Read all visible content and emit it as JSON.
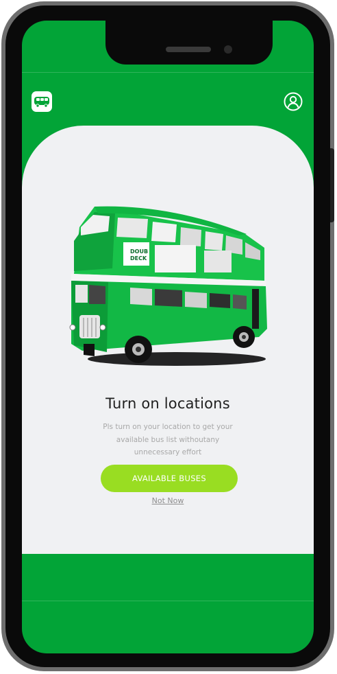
{
  "colors": {
    "primary": "#02a437",
    "card": "#f0f1f3",
    "cta": "#99dd22"
  },
  "header": {
    "logo_icon": "bus-logo-icon",
    "profile_icon": "user-profile-icon"
  },
  "location_prompt": {
    "illustration": "double-decker-bus",
    "title": "Turn on locations",
    "description_lines": [
      "Pls turn on your location to get your",
      "available bus list withoutany",
      "unnecessary effort"
    ],
    "primary_button": "AVAILABLE BUSES",
    "secondary_link": "Not Now"
  }
}
